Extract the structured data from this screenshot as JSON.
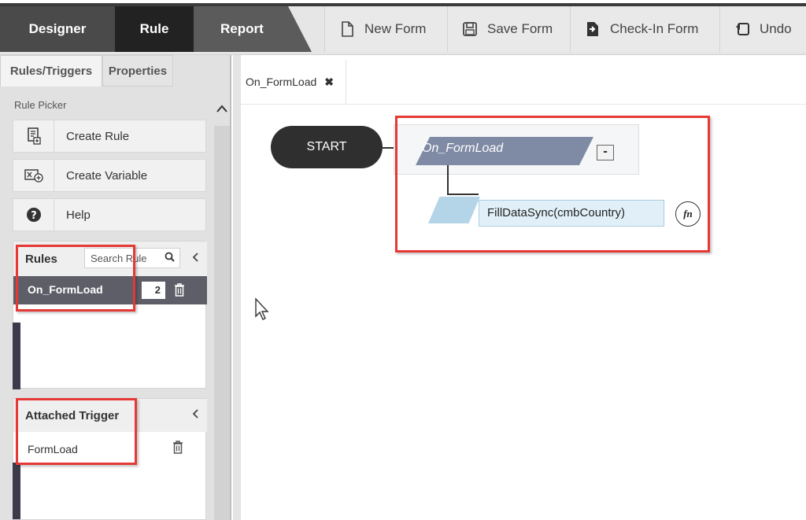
{
  "tabs": {
    "designer": "Designer",
    "rule": "Rule",
    "report": "Report"
  },
  "toolbar": {
    "new_form": "New Form",
    "save_form": "Save Form",
    "check_in_form": "Check-In Form",
    "undo": "Undo"
  },
  "left_panel": {
    "subtabs": [
      "Rules/Triggers",
      "Properties"
    ],
    "picker_title": "Rule Picker",
    "picker_items": [
      "Create Rule",
      "Create Variable",
      "Help"
    ]
  },
  "rules": {
    "title": "Rules",
    "search_placeholder": "Search Rule",
    "items": [
      {
        "name": "On_FormLoad",
        "count": "2"
      }
    ]
  },
  "attached_trigger": {
    "title": "Attached Trigger",
    "items": [
      "FormLoad"
    ]
  },
  "canvas": {
    "tab_label": "On_FormLoad",
    "start_label": "START",
    "rule_node_label": "On_FormLoad",
    "collapse_symbol": "-",
    "action_label": "FillDataSync(cmbCountry)",
    "fn_label": "fn"
  },
  "colors": {
    "rule_tab_active": "#222222",
    "selected_rule_row": "#5e5e68",
    "rule_node": "#7f8aa4",
    "action_node": "#e1f0f8",
    "highlight": "#e53935"
  }
}
